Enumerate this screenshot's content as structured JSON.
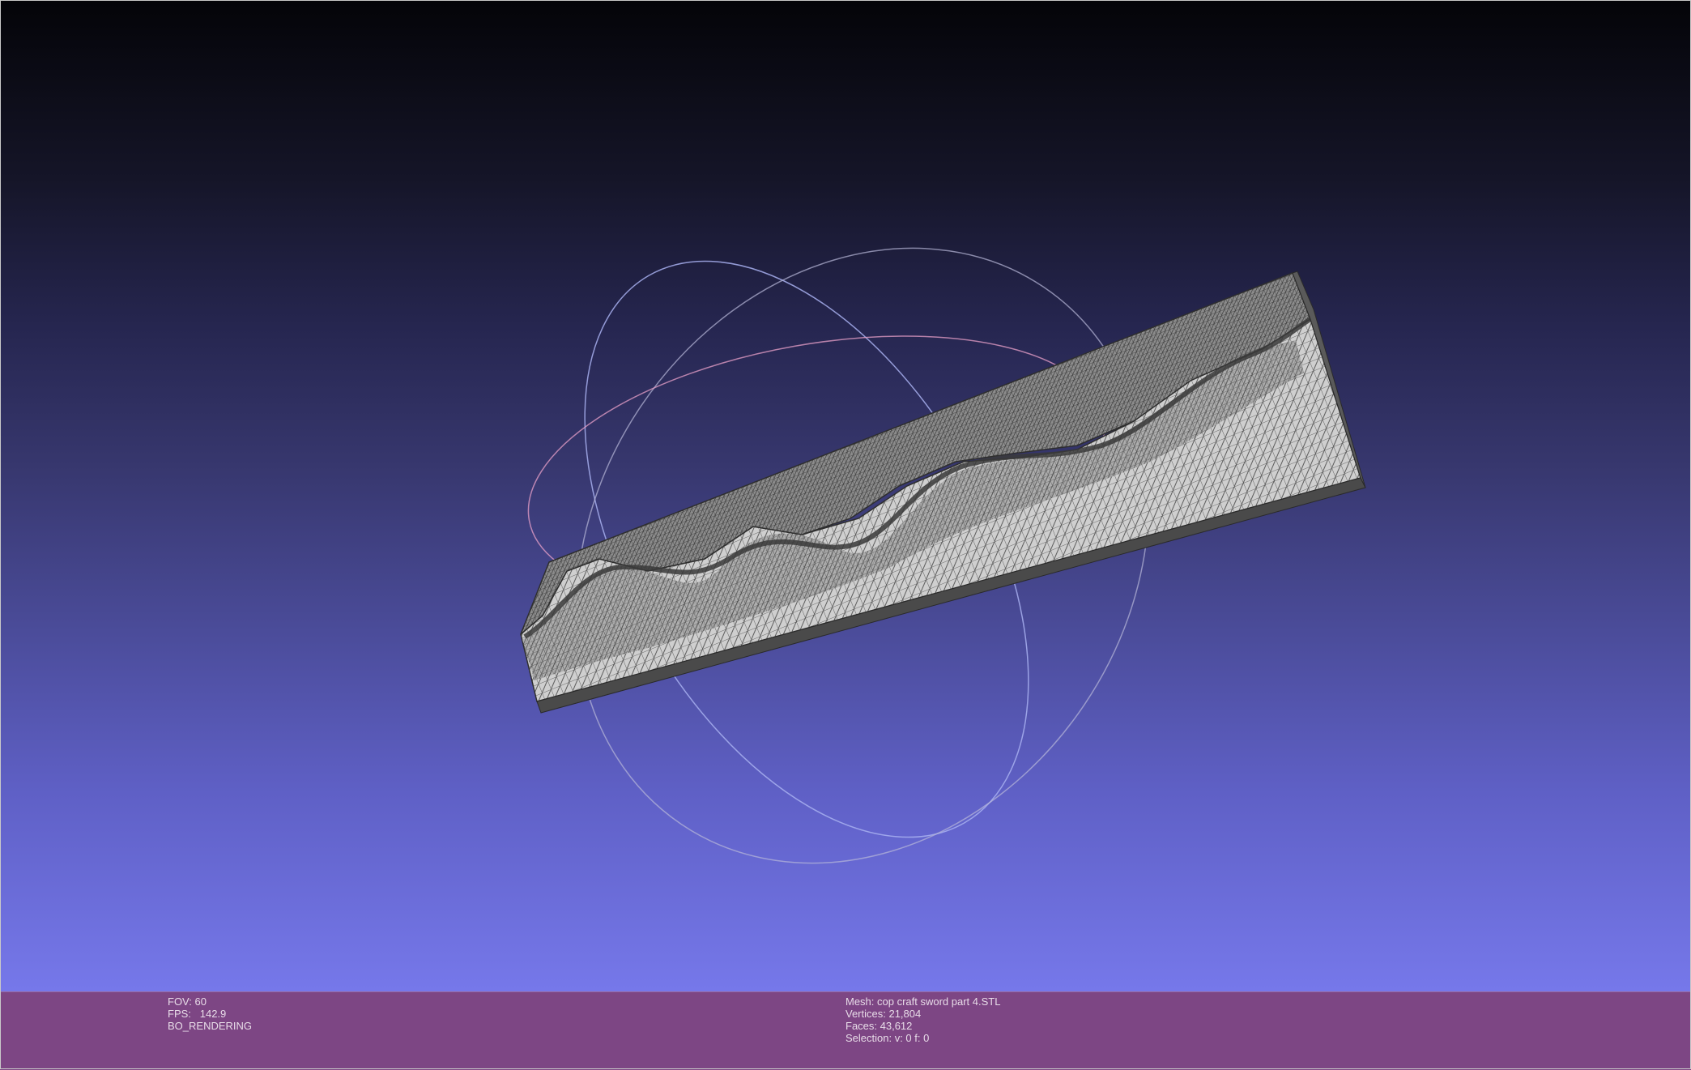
{
  "render_info": {
    "fov": "FOV: 60",
    "fps": "FPS:   142.9",
    "mode": "BO_RENDERING"
  },
  "mesh_info": {
    "mesh": "Mesh: cop craft sword part 4.STL",
    "vertices": "Vertices: 21,804",
    "faces": "Faces: 43,612",
    "selection": "Selection: v: 0 f: 0"
  },
  "colors": {
    "status_bar": "#7d4684",
    "status_text": "#e8dce8",
    "mesh_fill": "#cfcfcf",
    "mesh_wire": "#3c3c3c",
    "trackball_red": "#e8a0c8",
    "trackball_green": "#b8b8d8",
    "trackball_blue": "#a8b0f0"
  }
}
